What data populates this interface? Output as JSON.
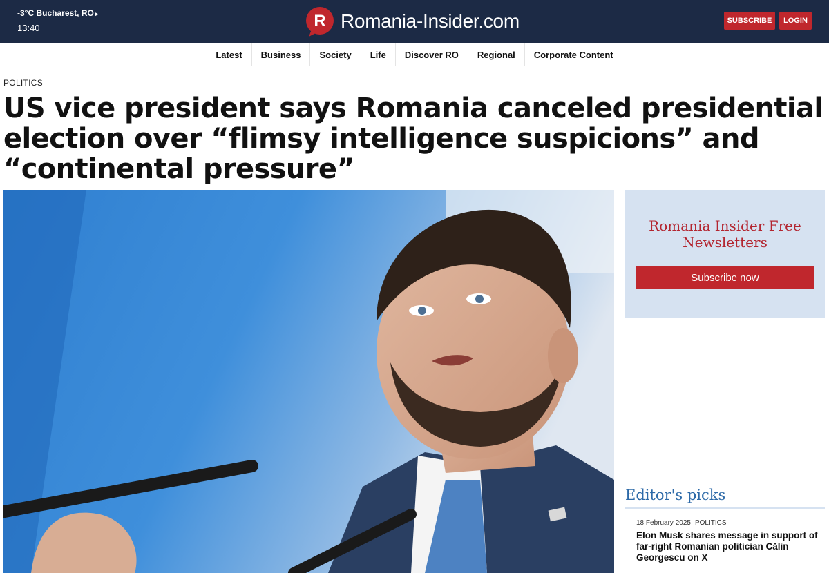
{
  "topbar": {
    "weather": "-3°C Bucharest, RO",
    "weather_arrow": "▸",
    "time": "13:40",
    "brand_letter": "R",
    "brand_name": "Romania-Insider.com",
    "subscribe_label": "SUBSCRIBE",
    "login_label": "LOGIN",
    "colors": {
      "bar": "#1c2a45",
      "accent": "#c0272d"
    }
  },
  "nav": {
    "items": [
      {
        "label": "Latest"
      },
      {
        "label": "Business"
      },
      {
        "label": "Society"
      },
      {
        "label": "Life"
      },
      {
        "label": "Discover RO"
      },
      {
        "label": "Regional"
      },
      {
        "label": "Corporate Content"
      }
    ]
  },
  "article": {
    "category": "POLITICS",
    "headline": "US vice president says Romania canceled presidential election over “flimsy intelligence suspicions” and “continental pressure”"
  },
  "sidebar": {
    "newsletter": {
      "title": "Romania Insider Free Newsletters",
      "button": "Subscribe now"
    },
    "editors_picks": {
      "title": "Editor's picks",
      "items": [
        {
          "date": "18 February 2025",
          "category": "POLITICS",
          "title": "Elon Musk shares message in support of far-right Romanian politician Călin Georgescu on X"
        }
      ]
    }
  }
}
